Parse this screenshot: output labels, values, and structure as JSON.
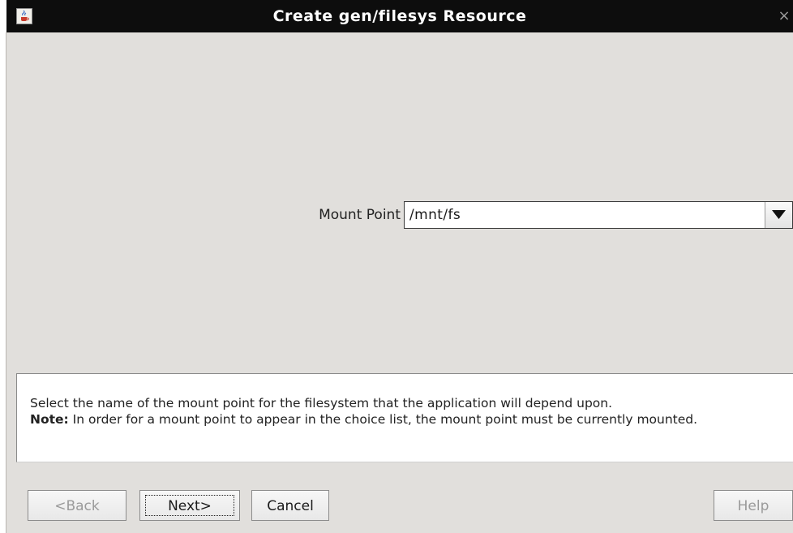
{
  "window": {
    "title": "Create gen/filesys Resource",
    "close_glyph": "×",
    "icon": "java-coffee-icon"
  },
  "form": {
    "mount_point_label": "Mount Point",
    "mount_point_value": "/mnt/fs"
  },
  "description": {
    "line1": "Select the name of the mount point for the filesystem that the application will depend upon.",
    "note_label": "Note:",
    "note_text": " In order for a mount point to appear in the choice list, the mount point must be currently mounted."
  },
  "buttons": {
    "back_label": "<Back",
    "next_label": "Next>",
    "cancel_label": "Cancel",
    "help_label": "Help"
  },
  "colors": {
    "titlebar": "#0d0d0d",
    "window_background": "#e1dfdc",
    "disabled_text": "#9a9a9a"
  }
}
